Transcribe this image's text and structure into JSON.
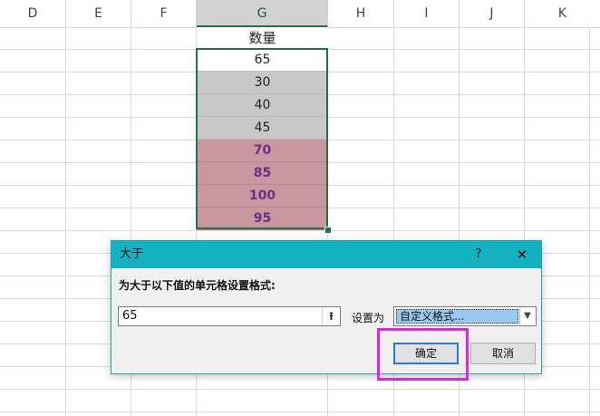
{
  "columns": [
    "D",
    "E",
    "F",
    "G",
    "H",
    "I",
    "J",
    "K"
  ],
  "selected_column": "G",
  "column_g": {
    "header": "数量",
    "cells": [
      {
        "value": "65",
        "fill": "white"
      },
      {
        "value": "30",
        "fill": "gray"
      },
      {
        "value": "40",
        "fill": "gray"
      },
      {
        "value": "45",
        "fill": "gray"
      },
      {
        "value": "70",
        "fill": "pink"
      },
      {
        "value": "85",
        "fill": "pink"
      },
      {
        "value": "100",
        "fill": "pink"
      },
      {
        "value": "95",
        "fill": "pink"
      }
    ]
  },
  "colors": {
    "gray_fill": "#c8c8c8",
    "pink_fill": "#c8979f",
    "pink_text": "#6b2f86",
    "selection": "#217346",
    "titlebar": "#14b2c0",
    "highlight": "#e025e0"
  },
  "dialog": {
    "title": "大于",
    "help": "?",
    "close_icon": "close-icon",
    "instruction": "为大于以下值的单元格设置格式:",
    "value": "65",
    "set_label": "设置为",
    "format_value": "自定义格式...",
    "ok_label": "确定",
    "cancel_label": "取消"
  }
}
